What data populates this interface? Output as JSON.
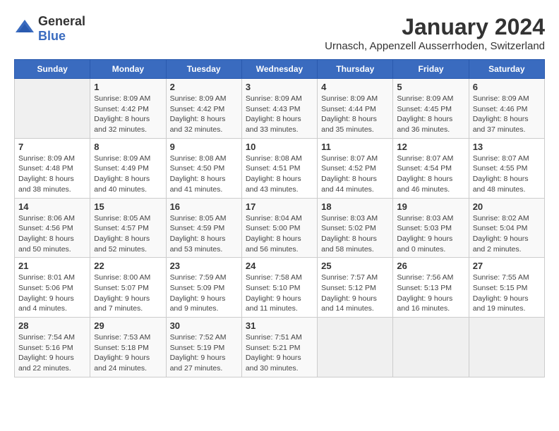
{
  "logo": {
    "general": "General",
    "blue": "Blue"
  },
  "title": "January 2024",
  "subtitle": "Urnasch, Appenzell Ausserrhoden, Switzerland",
  "weekdays": [
    "Sunday",
    "Monday",
    "Tuesday",
    "Wednesday",
    "Thursday",
    "Friday",
    "Saturday"
  ],
  "weeks": [
    [
      {
        "day": "",
        "detail": ""
      },
      {
        "day": "1",
        "detail": "Sunrise: 8:09 AM\nSunset: 4:42 PM\nDaylight: 8 hours\nand 32 minutes."
      },
      {
        "day": "2",
        "detail": "Sunrise: 8:09 AM\nSunset: 4:42 PM\nDaylight: 8 hours\nand 32 minutes."
      },
      {
        "day": "3",
        "detail": "Sunrise: 8:09 AM\nSunset: 4:43 PM\nDaylight: 8 hours\nand 33 minutes."
      },
      {
        "day": "4",
        "detail": "Sunrise: 8:09 AM\nSunset: 4:44 PM\nDaylight: 8 hours\nand 35 minutes."
      },
      {
        "day": "5",
        "detail": "Sunrise: 8:09 AM\nSunset: 4:45 PM\nDaylight: 8 hours\nand 36 minutes."
      },
      {
        "day": "6",
        "detail": "Sunrise: 8:09 AM\nSunset: 4:46 PM\nDaylight: 8 hours\nand 37 minutes."
      }
    ],
    [
      {
        "day": "7",
        "detail": "Sunrise: 8:09 AM\nSunset: 4:48 PM\nDaylight: 8 hours\nand 38 minutes."
      },
      {
        "day": "8",
        "detail": "Sunrise: 8:09 AM\nSunset: 4:49 PM\nDaylight: 8 hours\nand 40 minutes."
      },
      {
        "day": "9",
        "detail": "Sunrise: 8:08 AM\nSunset: 4:50 PM\nDaylight: 8 hours\nand 41 minutes."
      },
      {
        "day": "10",
        "detail": "Sunrise: 8:08 AM\nSunset: 4:51 PM\nDaylight: 8 hours\nand 43 minutes."
      },
      {
        "day": "11",
        "detail": "Sunrise: 8:07 AM\nSunset: 4:52 PM\nDaylight: 8 hours\nand 44 minutes."
      },
      {
        "day": "12",
        "detail": "Sunrise: 8:07 AM\nSunset: 4:54 PM\nDaylight: 8 hours\nand 46 minutes."
      },
      {
        "day": "13",
        "detail": "Sunrise: 8:07 AM\nSunset: 4:55 PM\nDaylight: 8 hours\nand 48 minutes."
      }
    ],
    [
      {
        "day": "14",
        "detail": "Sunrise: 8:06 AM\nSunset: 4:56 PM\nDaylight: 8 hours\nand 50 minutes."
      },
      {
        "day": "15",
        "detail": "Sunrise: 8:05 AM\nSunset: 4:57 PM\nDaylight: 8 hours\nand 52 minutes."
      },
      {
        "day": "16",
        "detail": "Sunrise: 8:05 AM\nSunset: 4:59 PM\nDaylight: 8 hours\nand 53 minutes."
      },
      {
        "day": "17",
        "detail": "Sunrise: 8:04 AM\nSunset: 5:00 PM\nDaylight: 8 hours\nand 56 minutes."
      },
      {
        "day": "18",
        "detail": "Sunrise: 8:03 AM\nSunset: 5:02 PM\nDaylight: 8 hours\nand 58 minutes."
      },
      {
        "day": "19",
        "detail": "Sunrise: 8:03 AM\nSunset: 5:03 PM\nDaylight: 9 hours\nand 0 minutes."
      },
      {
        "day": "20",
        "detail": "Sunrise: 8:02 AM\nSunset: 5:04 PM\nDaylight: 9 hours\nand 2 minutes."
      }
    ],
    [
      {
        "day": "21",
        "detail": "Sunrise: 8:01 AM\nSunset: 5:06 PM\nDaylight: 9 hours\nand 4 minutes."
      },
      {
        "day": "22",
        "detail": "Sunrise: 8:00 AM\nSunset: 5:07 PM\nDaylight: 9 hours\nand 7 minutes."
      },
      {
        "day": "23",
        "detail": "Sunrise: 7:59 AM\nSunset: 5:09 PM\nDaylight: 9 hours\nand 9 minutes."
      },
      {
        "day": "24",
        "detail": "Sunrise: 7:58 AM\nSunset: 5:10 PM\nDaylight: 9 hours\nand 11 minutes."
      },
      {
        "day": "25",
        "detail": "Sunrise: 7:57 AM\nSunset: 5:12 PM\nDaylight: 9 hours\nand 14 minutes."
      },
      {
        "day": "26",
        "detail": "Sunrise: 7:56 AM\nSunset: 5:13 PM\nDaylight: 9 hours\nand 16 minutes."
      },
      {
        "day": "27",
        "detail": "Sunrise: 7:55 AM\nSunset: 5:15 PM\nDaylight: 9 hours\nand 19 minutes."
      }
    ],
    [
      {
        "day": "28",
        "detail": "Sunrise: 7:54 AM\nSunset: 5:16 PM\nDaylight: 9 hours\nand 22 minutes."
      },
      {
        "day": "29",
        "detail": "Sunrise: 7:53 AM\nSunset: 5:18 PM\nDaylight: 9 hours\nand 24 minutes."
      },
      {
        "day": "30",
        "detail": "Sunrise: 7:52 AM\nSunset: 5:19 PM\nDaylight: 9 hours\nand 27 minutes."
      },
      {
        "day": "31",
        "detail": "Sunrise: 7:51 AM\nSunset: 5:21 PM\nDaylight: 9 hours\nand 30 minutes."
      },
      {
        "day": "",
        "detail": ""
      },
      {
        "day": "",
        "detail": ""
      },
      {
        "day": "",
        "detail": ""
      }
    ]
  ]
}
